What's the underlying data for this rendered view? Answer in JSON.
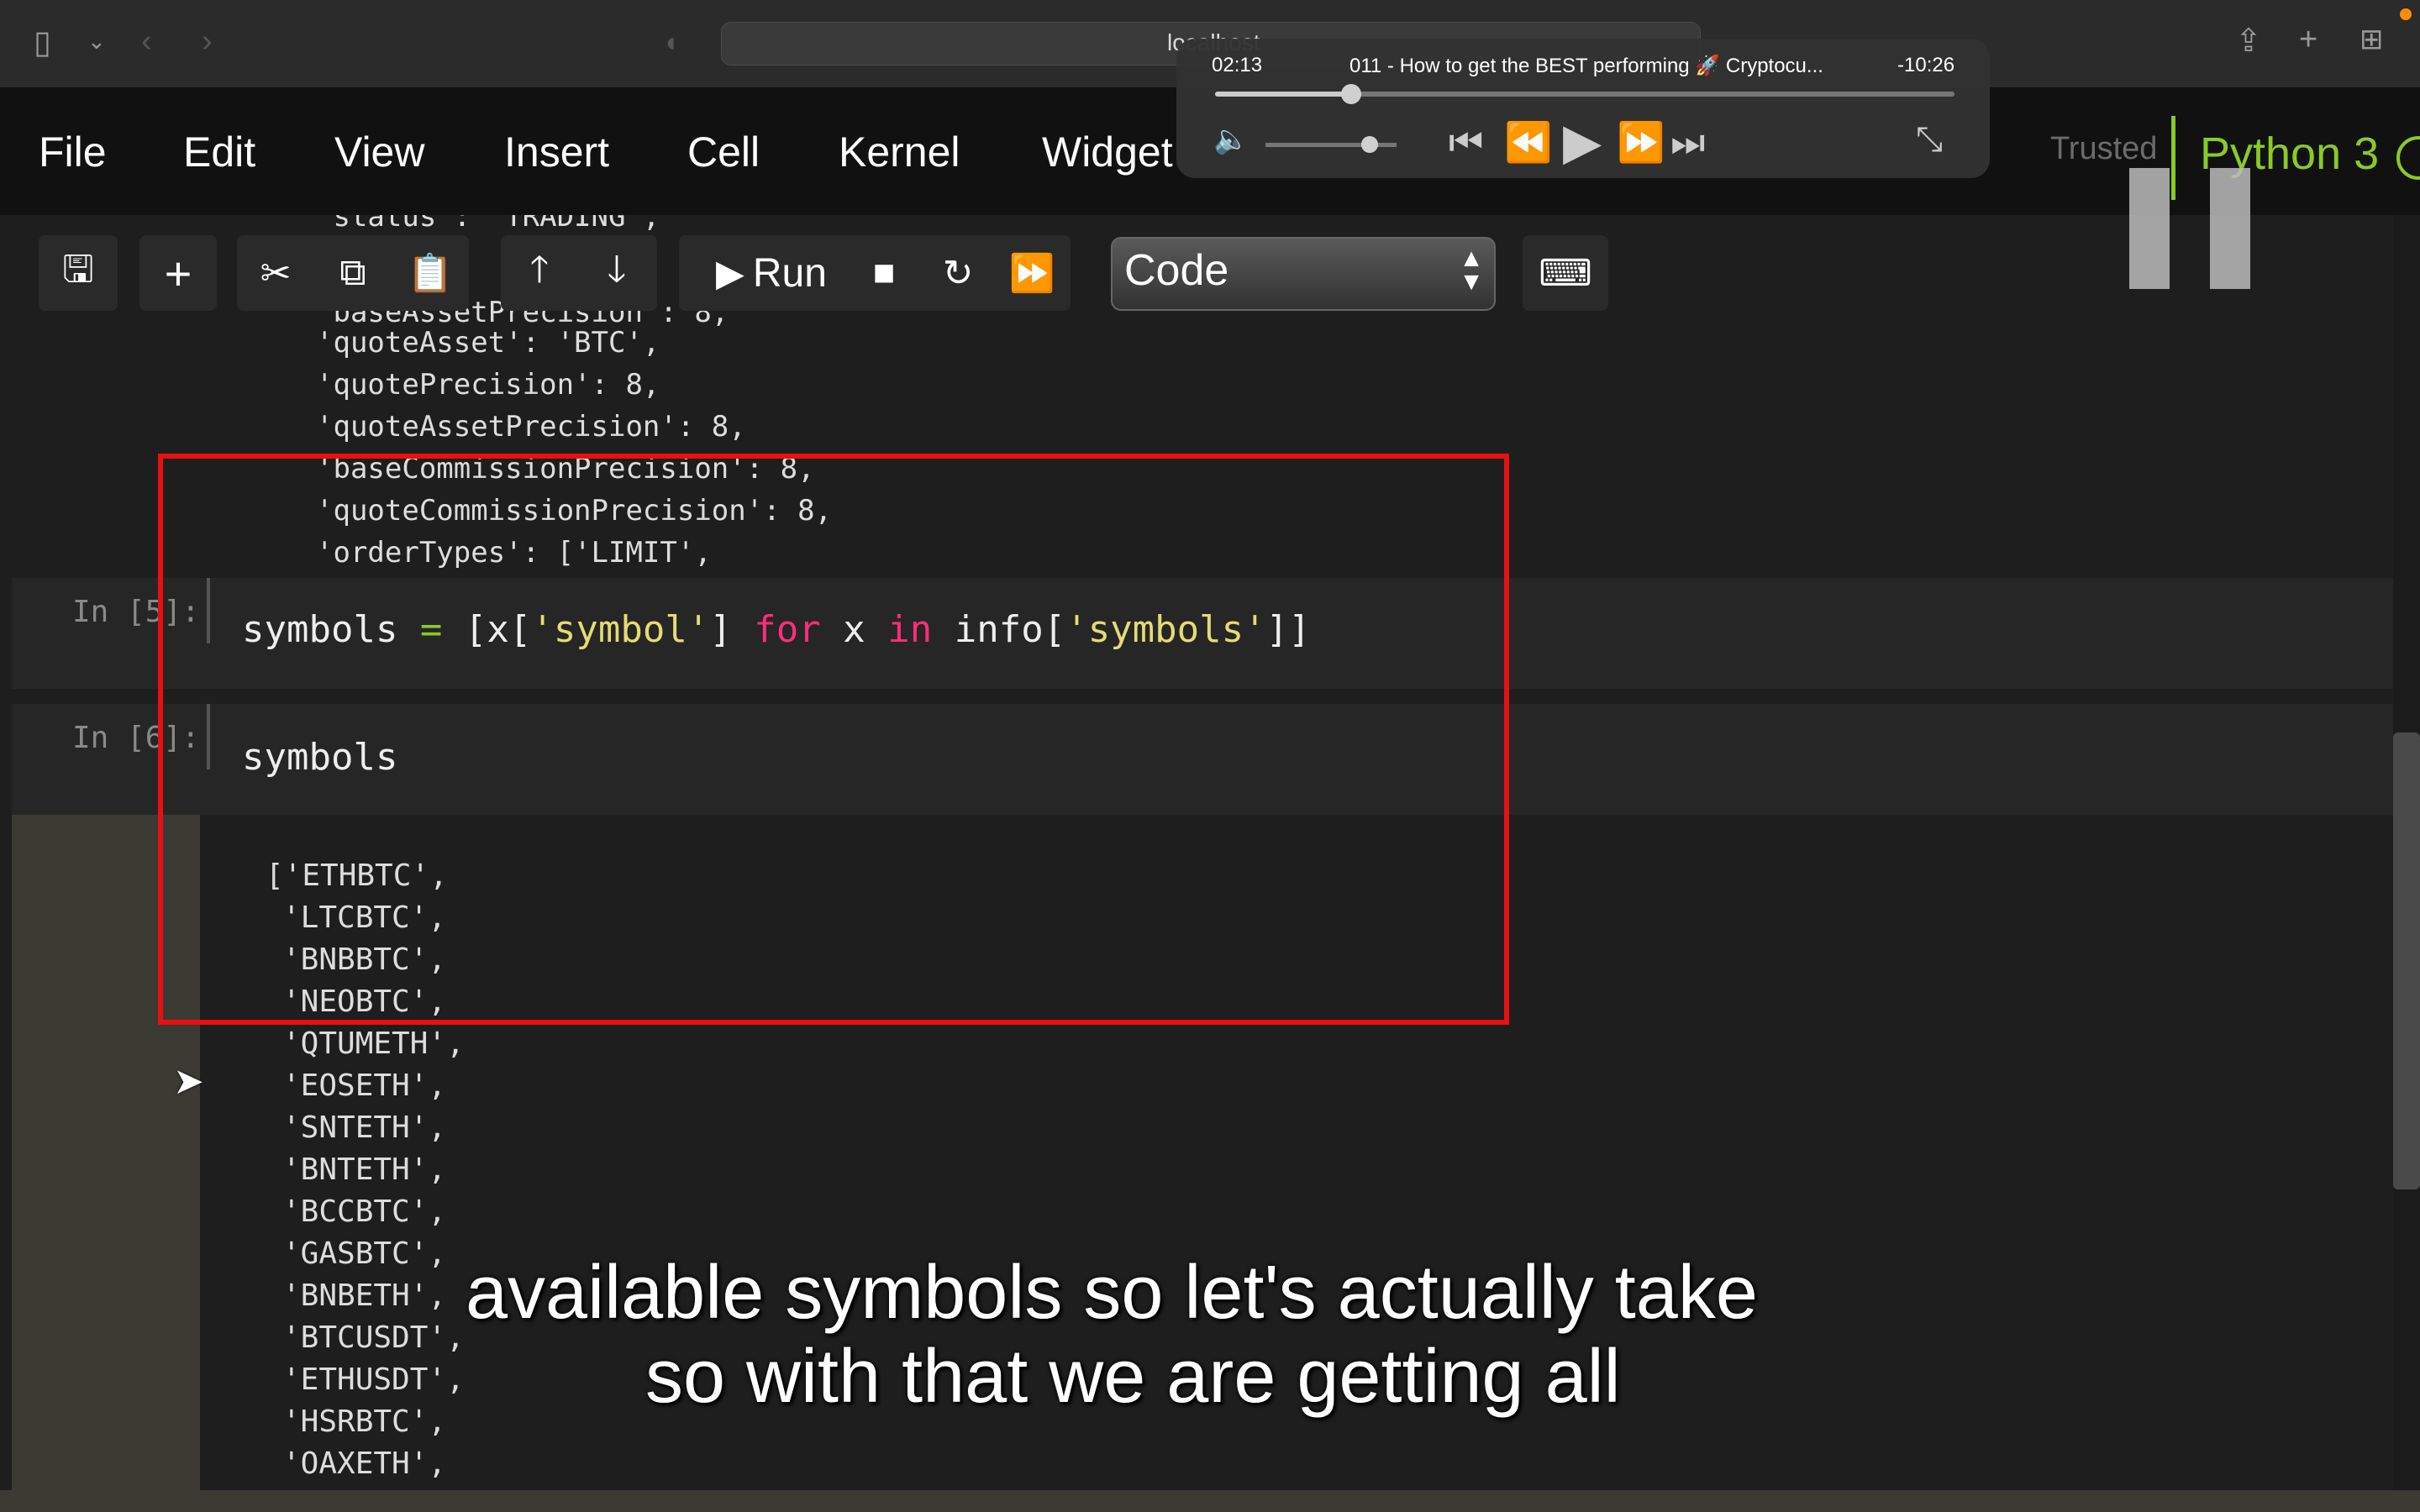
{
  "browser": {
    "url": "localhost",
    "icons": [
      "sidebar-icon",
      "chevron-down-icon",
      "back-icon",
      "forward-icon",
      "shield-icon",
      "share-icon",
      "new-tab-icon",
      "tab-overview-icon"
    ]
  },
  "menubar": {
    "items": [
      "File",
      "Edit",
      "View",
      "Insert",
      "Cell",
      "Kernel",
      "Widget"
    ],
    "trusted": "Trusted",
    "kernel": "Python 3"
  },
  "toolbar": {
    "run_label": "Run",
    "cell_type": "Code"
  },
  "prev_output_lines": [
    "'status': 'TRADING',",
    "'baseAssetPrecision': 8,",
    "'quoteAsset': 'BTC',",
    "'quotePrecision': 8,",
    "'quoteAssetPrecision': 8,",
    "'baseCommissionPrecision': 8,",
    "'quoteCommissionPrecision': 8,",
    "'orderTypes': ['LIMIT',"
  ],
  "cells": [
    {
      "prompt": "In [5]:",
      "code_parts": [
        "symbols ",
        "=",
        " [x[",
        "'symbol'",
        "] ",
        "for",
        " x ",
        "in",
        " info[",
        "'symbols'",
        "]]"
      ]
    },
    {
      "prompt": "In [6]:",
      "code": "symbols"
    }
  ],
  "symbols_output": [
    "['ETHBTC',",
    "'LTCBTC',",
    "'BNBBTC',",
    "'NEOBTC',",
    "'QTUMETH',",
    "'EOSETH',",
    "'SNTETH',",
    "'BNTETH',",
    "'BCCBTC',",
    "'GASBTC',",
    "'BNBETH',",
    "'BTCUSDT',",
    "'ETHUSDT',",
    "'HSRBTC',",
    "'OAXETH',"
  ],
  "player": {
    "elapsed": "02:13",
    "title": "011 - How to get the BEST performing 🚀 Cryptocu...",
    "remaining": "-10:26",
    "progress": 0.18
  },
  "subtitles": {
    "line1": "available symbols so let's actually take",
    "line2": "so with that we are getting all"
  },
  "colors": {
    "highlight_box": "#e81010",
    "kernel_green": "#8ac926",
    "keyword_pink": "#ff2d78",
    "string_yellow": "#e6db74"
  }
}
